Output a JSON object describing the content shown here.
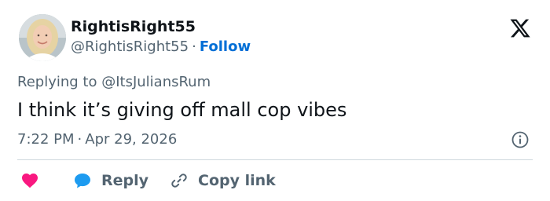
{
  "author": {
    "display_name": "RightisRight55",
    "handle": "@RightisRight55",
    "separator": "·",
    "follow_label": "Follow",
    "avatar_icon": "profile-photo"
  },
  "brand": {
    "logo_icon": "x-logo"
  },
  "tweet": {
    "replying_to": "Replying to @ItsJuliansRum",
    "text": "I think it’s giving off mall cop vibes",
    "time": "7:22 PM",
    "separator": "·",
    "date": "Apr 29, 2026",
    "info_icon": "info-icon"
  },
  "actions": {
    "like_icon": "heart-icon",
    "reply_icon": "speech-bubble-icon",
    "reply_label": "Reply",
    "copy_icon": "link-icon",
    "copy_label": "Copy link"
  },
  "colors": {
    "text": "#0f1419",
    "muted": "#536471",
    "link": "#006fd6",
    "like": "#f91880",
    "reply": "#1d9bf0",
    "divider": "#cfd9de"
  }
}
